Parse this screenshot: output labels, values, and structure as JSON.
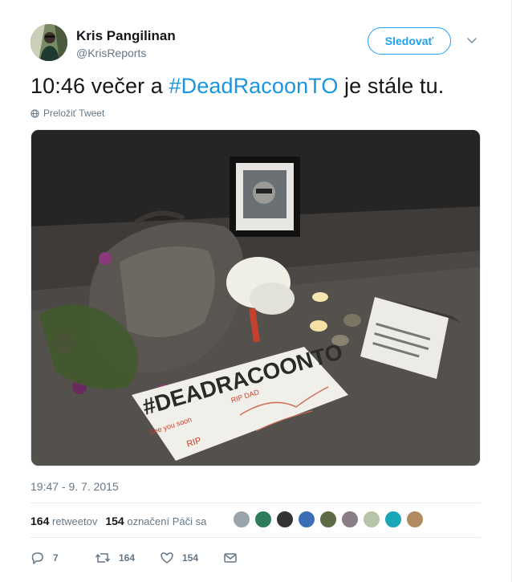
{
  "author": {
    "name": "Kris Pangilinan",
    "handle": "@KrisReports"
  },
  "follow_button": {
    "label": "Sledovať"
  },
  "tweet": {
    "text_before": "10:46 večer a ",
    "hashtag": "#DeadRacoonTO",
    "text_after": " je stále tu.",
    "translate_label": "Preložiť Tweet"
  },
  "media": {
    "photo_sign_text": "#DEADRACOONTO",
    "photo_sign_notes": [
      "RIP",
      "See you soon",
      "RIP DAD"
    ]
  },
  "timestamp": "19:47 - 9. 7. 2015",
  "stats": {
    "retweets_count": "164",
    "retweets_label": "retweetov",
    "likes_count": "154",
    "likes_label": "označení Páči sa"
  },
  "likers": [
    {
      "color": "#9aa4ad"
    },
    {
      "color": "#2e7d5a"
    },
    {
      "color": "#333333"
    },
    {
      "color": "#3b6fb5"
    },
    {
      "color": "#5c6b45"
    },
    {
      "color": "#8a7d85"
    },
    {
      "color": "#b7c4a8"
    },
    {
      "color": "#18a6b8"
    },
    {
      "color": "#b08a60"
    }
  ],
  "actions": {
    "reply_count": "7",
    "retweet_count": "164",
    "like_count": "154"
  },
  "colors": {
    "accent": "#1da1f2",
    "hashtag": "#1b95e0",
    "muted": "#657786"
  }
}
